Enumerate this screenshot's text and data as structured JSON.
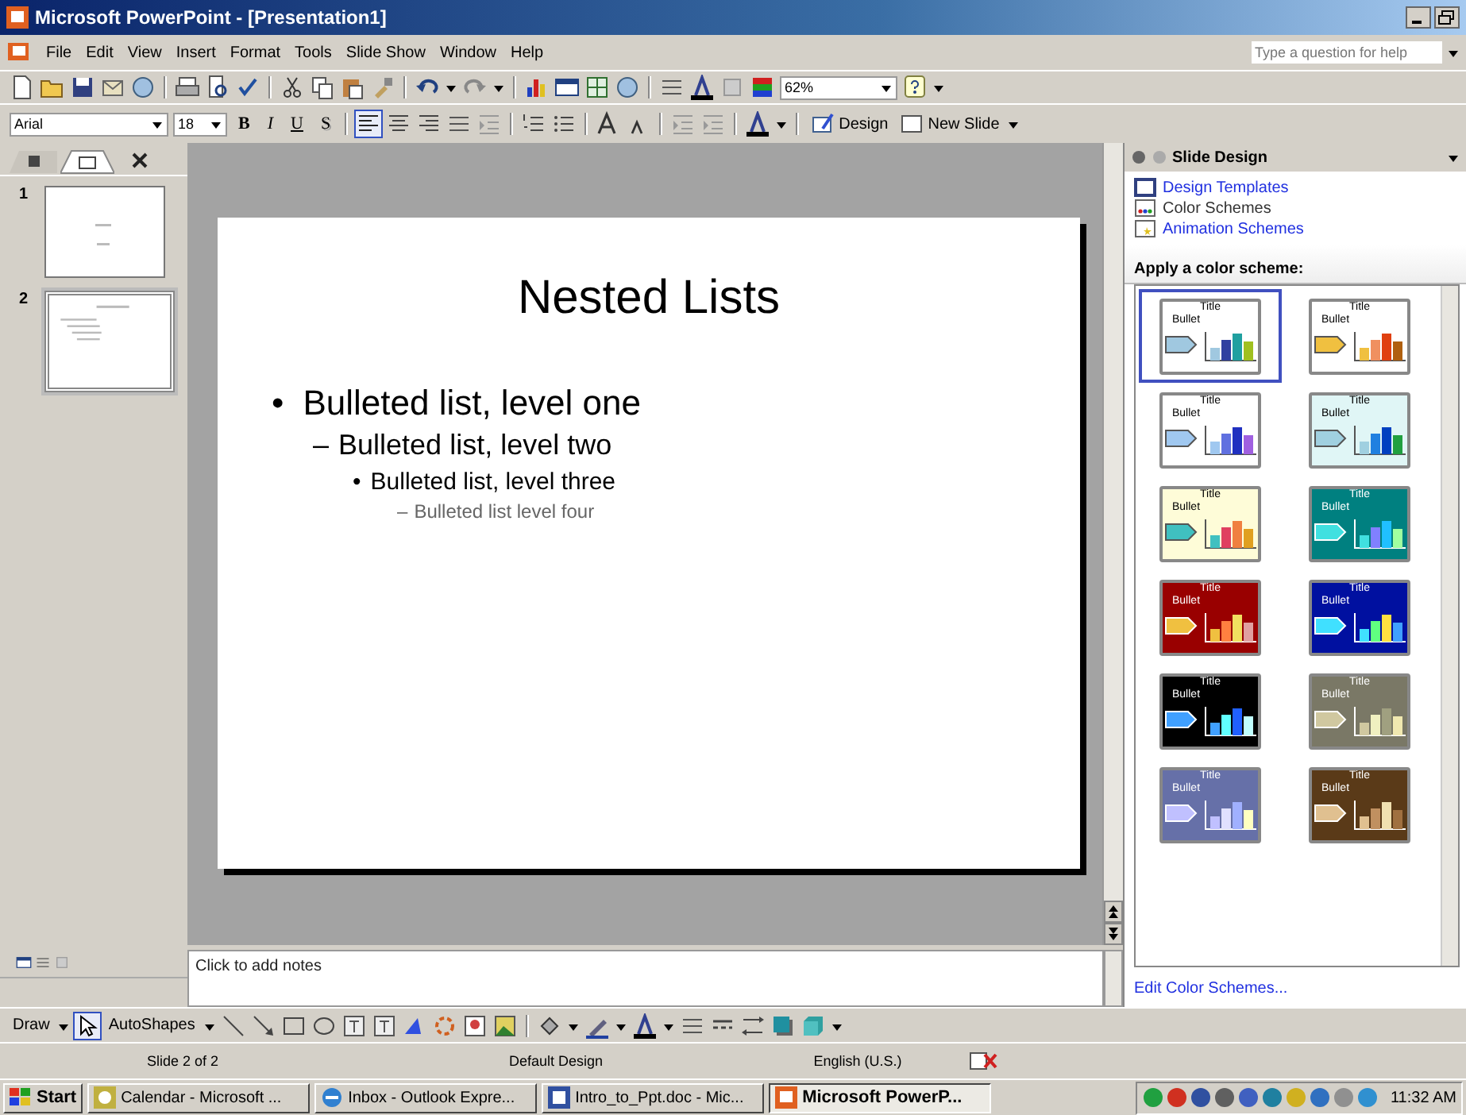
{
  "window": {
    "title": "Microsoft PowerPoint - [Presentation1]"
  },
  "menu": [
    {
      "label": "File"
    },
    {
      "label": "Edit"
    },
    {
      "label": "View"
    },
    {
      "label": "Insert"
    },
    {
      "label": "Format"
    },
    {
      "label": "Tools"
    },
    {
      "label": "Slide Show"
    },
    {
      "label": "Window"
    },
    {
      "label": "Help"
    }
  ],
  "help_box": {
    "placeholder": "Type a question for help"
  },
  "standard_toolbar": {
    "zoom": "62%"
  },
  "formatting_toolbar": {
    "font": "Arial",
    "size": "18",
    "styles": [
      {
        "label": "B",
        "kind": "bold"
      },
      {
        "label": "I",
        "kind": "italic"
      },
      {
        "label": "U",
        "kind": "underline"
      },
      {
        "label": "S",
        "kind": "shadow"
      }
    ],
    "design_button": "Design",
    "new_slide_button": "New Slide"
  },
  "slides_pane": {
    "slides": [
      {
        "number": "1",
        "selected": false
      },
      {
        "number": "2",
        "selected": true
      }
    ]
  },
  "slide": {
    "title": "Nested Lists",
    "bullets": [
      {
        "marker": "•",
        "text": "Bulleted list, level one",
        "children": [
          {
            "marker": "–",
            "text": "Bulleted list, level two",
            "children": [
              {
                "marker": "•",
                "text": "Bulleted list, level three",
                "children": [
                  {
                    "marker": "–",
                    "text": "Bulleted list level four"
                  }
                ]
              }
            ]
          }
        ]
      }
    ]
  },
  "notes": {
    "placeholder": "Click to add notes"
  },
  "task_pane": {
    "title": "Slide Design",
    "links": [
      {
        "label": "Design Templates",
        "selected": false
      },
      {
        "label": "Color Schemes",
        "selected": true
      },
      {
        "label": "Animation Schemes",
        "selected": false
      }
    ],
    "heading": "Apply a color scheme:",
    "schemes": [
      {
        "title": "Title",
        "bullet": "Bullet",
        "color": "#ffffff",
        "selected": true,
        "bars": [
          {
            "color": "#a0c8e0"
          },
          {
            "color": "#3040a0"
          },
          {
            "color": "#20a0a0"
          },
          {
            "color": "#a0c020"
          }
        ]
      },
      {
        "title": "Title",
        "bullet": "Bullet",
        "color": "#ffffff",
        "selected": false,
        "bars": [
          {
            "color": "#f0c040"
          },
          {
            "color": "#f09060"
          },
          {
            "color": "#e04010"
          },
          {
            "color": "#b06010"
          }
        ]
      },
      {
        "title": "Title",
        "bullet": "Bullet",
        "color": "#ffffff",
        "selected": false,
        "bars": [
          {
            "color": "#a0c8f0"
          },
          {
            "color": "#6070e0"
          },
          {
            "color": "#2030c0"
          },
          {
            "color": "#a060e0"
          }
        ]
      },
      {
        "title": "Title",
        "bullet": "Bullet",
        "color": "#e0f6f6",
        "selected": false,
        "bars": [
          {
            "color": "#a0d0e0"
          },
          {
            "color": "#2080e0"
          },
          {
            "color": "#0040c0"
          },
          {
            "color": "#20a040"
          }
        ]
      },
      {
        "title": "Title",
        "bullet": "Bullet",
        "color": "#fefcd8",
        "selected": false,
        "bars": [
          {
            "color": "#40c0c0"
          },
          {
            "color": "#e04060"
          },
          {
            "color": "#f08040"
          },
          {
            "color": "#e0a020"
          }
        ]
      },
      {
        "title": "Title",
        "bullet": "Bullet",
        "color": "#008080",
        "selected": false,
        "bars": [
          {
            "color": "#40e0e0"
          },
          {
            "color": "#8080ff"
          },
          {
            "color": "#20c0ff"
          },
          {
            "color": "#a0ffa0"
          }
        ]
      },
      {
        "title": "Title",
        "bullet": "Bullet",
        "color": "#990000",
        "selected": false,
        "bars": [
          {
            "color": "#f0c040"
          },
          {
            "color": "#ff8040"
          },
          {
            "color": "#f0e060"
          },
          {
            "color": "#e0a0a0"
          }
        ]
      },
      {
        "title": "Title",
        "bullet": "Bullet",
        "color": "#0010a0",
        "selected": false,
        "bars": [
          {
            "color": "#40e0ff"
          },
          {
            "color": "#60ff80"
          },
          {
            "color": "#ffe040"
          },
          {
            "color": "#40a0ff"
          }
        ]
      },
      {
        "title": "Title",
        "bullet": "Bullet",
        "color": "#000000",
        "selected": false,
        "bars": [
          {
            "color": "#40a0ff"
          },
          {
            "color": "#60ffff"
          },
          {
            "color": "#2060ff"
          },
          {
            "color": "#c0ffff"
          }
        ]
      },
      {
        "title": "Title",
        "bullet": "Bullet",
        "color": "#7a7866",
        "selected": false,
        "bars": [
          {
            "color": "#d0c8a0"
          },
          {
            "color": "#f0f0c0"
          },
          {
            "color": "#a0a080"
          },
          {
            "color": "#f0e8b0"
          }
        ]
      },
      {
        "title": "Title",
        "bullet": "Bullet",
        "color": "#6670a8",
        "selected": false,
        "bars": [
          {
            "color": "#c0c0ff"
          },
          {
            "color": "#e0e0ff"
          },
          {
            "color": "#a0b0ff"
          },
          {
            "color": "#ffffc0"
          }
        ]
      },
      {
        "title": "Title",
        "bullet": "Bullet",
        "color": "#5a3a18",
        "selected": false,
        "bars": [
          {
            "color": "#e0c090"
          },
          {
            "color": "#c09060"
          },
          {
            "color": "#f0e0b0"
          },
          {
            "color": "#a07040"
          }
        ]
      }
    ],
    "footer_link": "Edit Color Schemes..."
  },
  "drawing_toolbar": {
    "draw": "Draw",
    "autoshapes": "AutoShapes"
  },
  "status_bar": [
    {
      "text": "Slide 2 of 2"
    },
    {
      "text": "Default Design"
    },
    {
      "text": "English (U.S.)"
    }
  ],
  "taskbar": {
    "start": "Start",
    "tasks": [
      {
        "label": "Calendar - Microsoft ...",
        "selected": false
      },
      {
        "label": "Inbox - Outlook Expre...",
        "selected": false
      },
      {
        "label": "Intro_to_Ppt.doc - Mic...",
        "selected": false
      },
      {
        "label": "Microsoft PowerP...",
        "selected": true
      }
    ],
    "clock": "11:32 AM"
  }
}
